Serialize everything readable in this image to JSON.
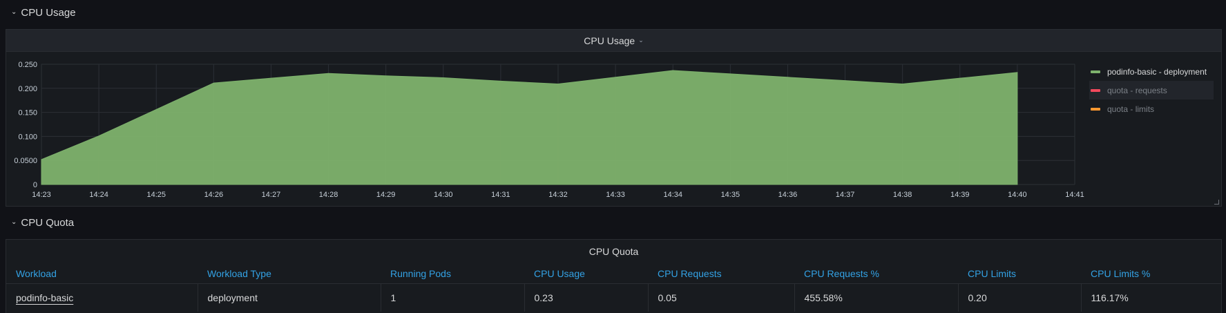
{
  "rows": {
    "cpu_usage_title": "CPU Usage",
    "cpu_quota_title": "CPU Quota"
  },
  "panels": {
    "cpu_usage_title": "CPU Usage",
    "cpu_quota_title": "CPU Quota"
  },
  "colors": {
    "series_fill": "#7eb26d",
    "requests": "#f2495c",
    "limits": "#ff9830",
    "link": "#33a2e5"
  },
  "icons": {
    "row_chevron": "chevron-down-icon",
    "panel_menu": "chevron-down-icon",
    "resize": "resize-handle-icon"
  },
  "chart_data": {
    "type": "area",
    "title": "CPU Usage",
    "xlabel": "",
    "ylabel": "",
    "x": [
      "14:23",
      "14:24",
      "14:25",
      "14:26",
      "14:27",
      "14:28",
      "14:29",
      "14:30",
      "14:31",
      "14:32",
      "14:33",
      "14:34",
      "14:35",
      "14:36",
      "14:37",
      "14:38",
      "14:39",
      "14:40",
      "14:41"
    ],
    "y_ticks": [
      "0",
      "0.0500",
      "0.100",
      "0.150",
      "0.200",
      "0.250"
    ],
    "ylim": [
      0,
      0.25
    ],
    "grid": true,
    "legend_position": "right",
    "series": [
      {
        "name": "podinfo-basic - deployment",
        "color": "#7eb26d",
        "points": [
          [
            0,
            0.052
          ],
          [
            1,
            0.101
          ],
          [
            2,
            0.156
          ],
          [
            3,
            0.211
          ],
          [
            4,
            0.221
          ],
          [
            5,
            0.231
          ],
          [
            6,
            0.226
          ],
          [
            7,
            0.222
          ],
          [
            8,
            0.215
          ],
          [
            9,
            0.209
          ],
          [
            10,
            0.223
          ],
          [
            11,
            0.237
          ],
          [
            12,
            0.23
          ],
          [
            13,
            0.223
          ],
          [
            14,
            0.216
          ],
          [
            15,
            0.209
          ],
          [
            16,
            0.221
          ],
          [
            17,
            0.233
          ]
        ]
      },
      {
        "name": "quota - requests",
        "color": "#f2495c",
        "points": []
      },
      {
        "name": "quota - limits",
        "color": "#ff9830",
        "points": []
      }
    ]
  },
  "legend": [
    {
      "label": "podinfo-basic - deployment",
      "color": "#7eb26d",
      "state": "active"
    },
    {
      "label": "quota - requests",
      "color": "#f2495c",
      "state": "hidden-hover"
    },
    {
      "label": "quota - limits",
      "color": "#ff9830",
      "state": "hidden"
    }
  ],
  "table": {
    "columns": [
      "Workload",
      "Workload Type",
      "Running Pods",
      "CPU Usage",
      "CPU Requests",
      "CPU Requests %",
      "CPU Limits",
      "CPU Limits %"
    ],
    "rows": [
      [
        "podinfo-basic",
        "deployment",
        "1",
        "0.23",
        "0.05",
        "455.58%",
        "0.20",
        "116.17%"
      ]
    ]
  }
}
